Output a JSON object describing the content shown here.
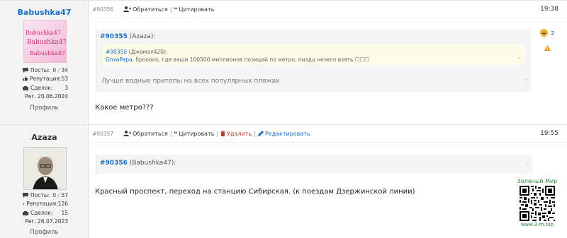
{
  "posts": [
    {
      "username": "Babushka47",
      "avatar_text": [
        "Babushka47",
        "Babushka47",
        "Babushka47"
      ],
      "stats": {
        "posts_label": "Посты:",
        "posts_value": "0",
        "posts_total": "34",
        "rep_label": "Репутация:",
        "rep_value": "53",
        "deals_label": "Сделок:",
        "deals_value": "3",
        "reg_label": "Рег. 20.06.2024"
      },
      "profile_label": "Профиль",
      "post_number": "#90356",
      "actions": {
        "reply": "Обратиться",
        "quote": "Цитировать"
      },
      "time": "19:38",
      "quote": {
        "link": "#90355",
        "author": "(Azaza):",
        "inner_link": "#90350",
        "inner_author": "(Джамал420):",
        "inner_name": "GrowPapa",
        "inner_text": ", брооооо, где ваши 100500 миллионов позиций по метро, пиздц нечего взять ☐☐☐",
        "text": "Лучше водные притопы на всех популярных пляжах"
      },
      "body": "Какое метро???",
      "reaction_count": "2"
    },
    {
      "username": "Azaza",
      "stats": {
        "posts_label": "Посты:",
        "posts_value": "0",
        "posts_total": "57",
        "rep_label": "Репутация:",
        "rep_value": "126",
        "deals_label": "Сделок:",
        "deals_value": "15",
        "reg_label": "Рег. 26.07.2023"
      },
      "profile_label": "Профиль",
      "post_number": "#90357",
      "actions": {
        "reply": "Обратиться",
        "quote": "Цитировать",
        "delete": "Удалить",
        "edit": "Редактировать"
      },
      "time": "19:55",
      "quote": {
        "link": "#90356",
        "author": "(Babushka47):"
      },
      "body": "Красный проспект, переход на станцию Сибирская. (к поездам Дзержинской линии)"
    }
  ],
  "ad": {
    "title": "Зеленый Мир",
    "url": "www.3-m.top"
  },
  "colors": {
    "link": "#1b6ec2",
    "accent_green": "#2e8b3d",
    "delete": "#c0392b"
  }
}
